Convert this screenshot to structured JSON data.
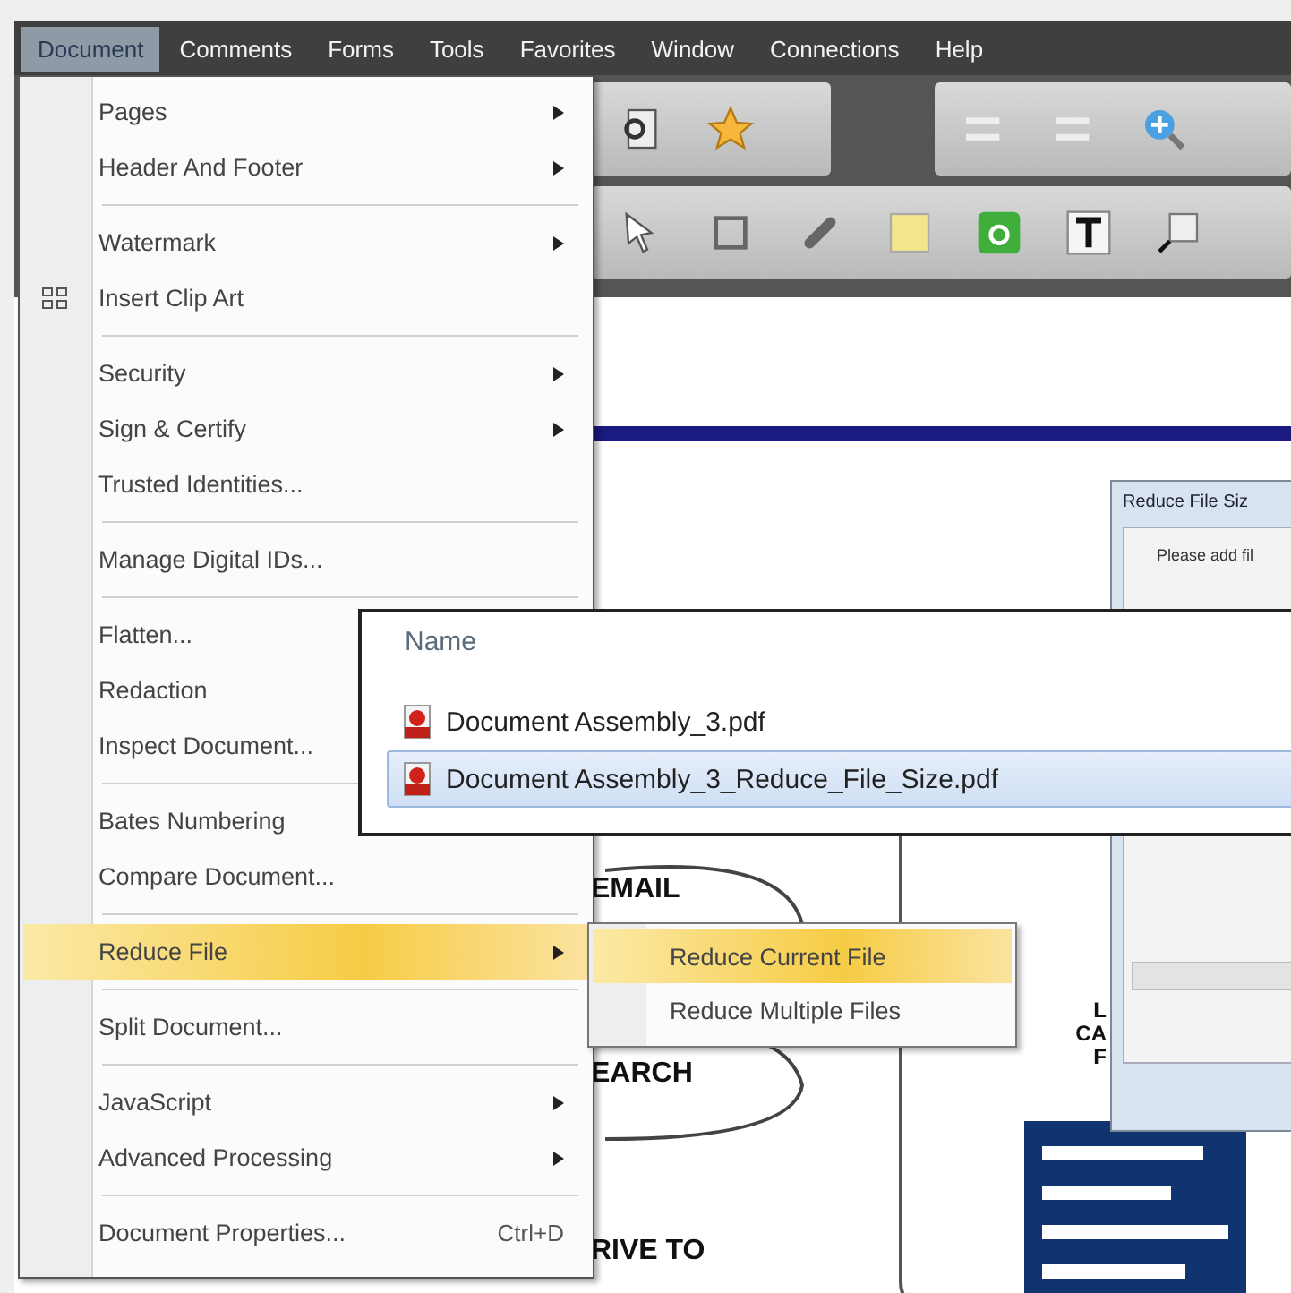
{
  "menubar": [
    {
      "label": "Document",
      "selected": true
    },
    {
      "label": "Comments",
      "selected": false
    },
    {
      "label": "Forms",
      "selected": false
    },
    {
      "label": "Tools",
      "selected": false
    },
    {
      "label": "Favorites",
      "selected": false
    },
    {
      "label": "Window",
      "selected": false
    },
    {
      "label": "Connections",
      "selected": false
    },
    {
      "label": "Help",
      "selected": false
    }
  ],
  "document_menu": {
    "sections": [
      [
        {
          "label": "Pages",
          "submenu": true,
          "icon": false,
          "selected": false
        },
        {
          "label": "Header And Footer",
          "submenu": true,
          "icon": false,
          "selected": false
        }
      ],
      [
        {
          "label": "Watermark",
          "submenu": true,
          "icon": false,
          "selected": false
        },
        {
          "label": "Insert Clip Art",
          "submenu": false,
          "icon": true,
          "selected": false
        }
      ],
      [
        {
          "label": "Security",
          "submenu": true,
          "icon": false,
          "selected": false
        },
        {
          "label": "Sign & Certify",
          "submenu": true,
          "icon": false,
          "selected": false
        },
        {
          "label": "Trusted Identities...",
          "submenu": false,
          "icon": false,
          "selected": false
        }
      ],
      [
        {
          "label": "Manage Digital IDs...",
          "submenu": false,
          "icon": false,
          "selected": false
        }
      ],
      [
        {
          "label": "Flatten...",
          "icon": false,
          "selected": false
        },
        {
          "label": "Redaction",
          "icon": false,
          "selected": false
        },
        {
          "label": "Inspect Document...",
          "icon": false,
          "selected": false
        }
      ],
      [
        {
          "label": "Bates Numbering",
          "icon": false,
          "selected": false
        },
        {
          "label": "Compare Document...",
          "icon": false,
          "selected": false
        }
      ],
      [
        {
          "label": "Reduce File",
          "submenu": true,
          "icon": false,
          "selected": true
        }
      ],
      [
        {
          "label": "Split Document...",
          "submenu": false,
          "icon": false,
          "selected": false
        }
      ],
      [
        {
          "label": "JavaScript",
          "submenu": true,
          "icon": false,
          "selected": false
        },
        {
          "label": "Advanced Processing",
          "submenu": true,
          "icon": false,
          "selected": false
        }
      ],
      [
        {
          "label": "Document Properties...",
          "submenu": false,
          "icon": false,
          "selected": false,
          "shortcut": "Ctrl+D"
        }
      ]
    ]
  },
  "reduce_submenu": [
    {
      "label": "Reduce Current File",
      "selected": true
    },
    {
      "label": "Reduce Multiple Files",
      "selected": false
    }
  ],
  "file_list": {
    "header": "Name",
    "files": [
      {
        "name": "Document Assembly_3.pdf",
        "selected": false
      },
      {
        "name": "Document Assembly_3_Reduce_File_Size.pdf",
        "selected": true
      }
    ]
  },
  "dialog": {
    "title": "Reduce File Siz",
    "text": "Please add fil"
  },
  "diagram_labels": [
    "EMAIL",
    "EARCH",
    "RIVE TO"
  ],
  "side_label": [
    "L",
    "CA",
    "F"
  ]
}
